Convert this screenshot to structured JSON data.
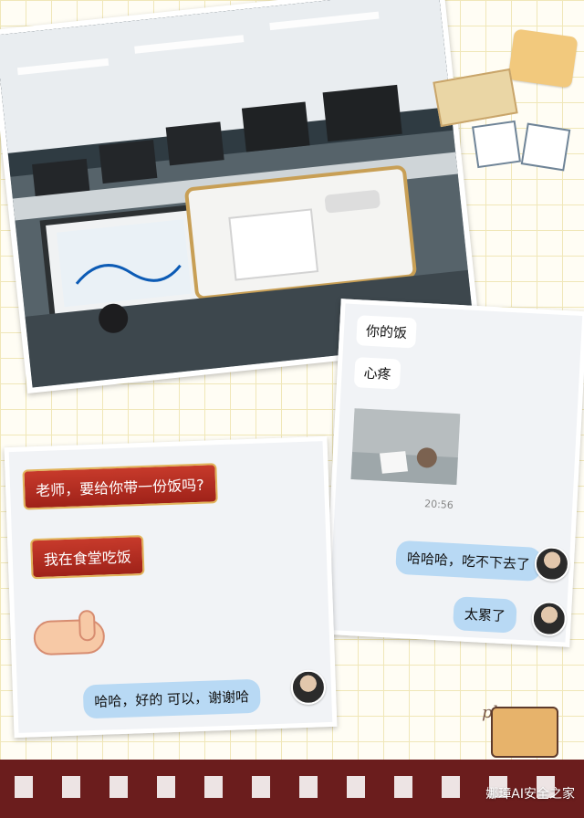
{
  "chat_right": {
    "messages": [
      {
        "text": "你的饭",
        "side": "left"
      },
      {
        "text": "心疼",
        "side": "left"
      },
      {
        "text": "哈哈哈，吃不下去了",
        "side": "right"
      },
      {
        "text": "太累了",
        "side": "right"
      }
    ],
    "time": "20:56"
  },
  "chat_left": {
    "messages": [
      {
        "text": "老师，要给你带一份饭吗?",
        "side": "left"
      },
      {
        "text": "我在食堂吃饭",
        "side": "left"
      },
      {
        "text": "哈哈，好的 可以，谢谢哈",
        "side": "right"
      }
    ]
  },
  "decorations": {
    "photo_label": "photo",
    "watermark": "娜璋AI安全之家",
    "hand_icon": "pointing-hand-icon",
    "avatar_icon": "avatar-icon"
  },
  "colors": {
    "background": "#fffdf4",
    "grid": "#f0e7b8",
    "accent": "#9f2219",
    "bubble_blue": "#b8d9f4"
  }
}
